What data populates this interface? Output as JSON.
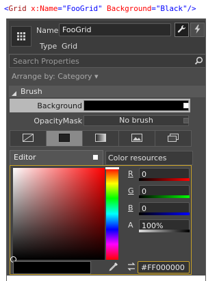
{
  "code_snippet": {
    "open": "<",
    "tag": "Grid",
    "attr1": " x:Name",
    "eq1": "=",
    "val1": "\"FooGrid\"",
    "attr2": " Background",
    "eq2": "=",
    "val2": "\"Black\"",
    "close": "/>"
  },
  "header": {
    "name_label": "Name",
    "name_value": "FooGrid",
    "type_label": "Type",
    "type_value": "Grid"
  },
  "search": {
    "placeholder": "Search Properties"
  },
  "arrange": {
    "label": "Arrange by: Category ▾"
  },
  "section": {
    "title": "Brush"
  },
  "properties": [
    {
      "label": "Background"
    },
    {
      "label": "OpacityMask",
      "value": "No brush"
    }
  ],
  "tabs": {
    "editor": "Editor",
    "color_resources": "Color resources"
  },
  "color_editor": {
    "channels": [
      {
        "key": "R",
        "value": "0"
      },
      {
        "key": "G",
        "value": "0"
      },
      {
        "key": "B",
        "value": "0"
      },
      {
        "key": "A",
        "value": "100%"
      }
    ],
    "hex": "#FF000000"
  },
  "colors": {
    "accent_border": "#c9a227",
    "panel_bg": "#4a4a4a",
    "selected_background_row": "#b9b9b9"
  }
}
